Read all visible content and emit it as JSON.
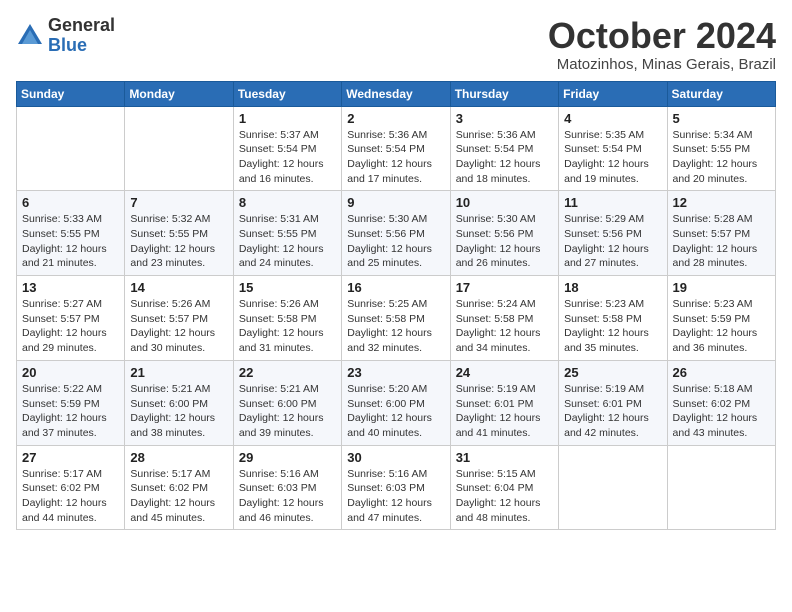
{
  "header": {
    "logo_general": "General",
    "logo_blue": "Blue",
    "month_title": "October 2024",
    "location": "Matozinhos, Minas Gerais, Brazil"
  },
  "weekdays": [
    "Sunday",
    "Monday",
    "Tuesday",
    "Wednesday",
    "Thursday",
    "Friday",
    "Saturday"
  ],
  "weeks": [
    [
      {
        "day": "",
        "info": ""
      },
      {
        "day": "",
        "info": ""
      },
      {
        "day": "1",
        "info": "Sunrise: 5:37 AM\nSunset: 5:54 PM\nDaylight: 12 hours and 16 minutes."
      },
      {
        "day": "2",
        "info": "Sunrise: 5:36 AM\nSunset: 5:54 PM\nDaylight: 12 hours and 17 minutes."
      },
      {
        "day": "3",
        "info": "Sunrise: 5:36 AM\nSunset: 5:54 PM\nDaylight: 12 hours and 18 minutes."
      },
      {
        "day": "4",
        "info": "Sunrise: 5:35 AM\nSunset: 5:54 PM\nDaylight: 12 hours and 19 minutes."
      },
      {
        "day": "5",
        "info": "Sunrise: 5:34 AM\nSunset: 5:55 PM\nDaylight: 12 hours and 20 minutes."
      }
    ],
    [
      {
        "day": "6",
        "info": "Sunrise: 5:33 AM\nSunset: 5:55 PM\nDaylight: 12 hours and 21 minutes."
      },
      {
        "day": "7",
        "info": "Sunrise: 5:32 AM\nSunset: 5:55 PM\nDaylight: 12 hours and 23 minutes."
      },
      {
        "day": "8",
        "info": "Sunrise: 5:31 AM\nSunset: 5:55 PM\nDaylight: 12 hours and 24 minutes."
      },
      {
        "day": "9",
        "info": "Sunrise: 5:30 AM\nSunset: 5:56 PM\nDaylight: 12 hours and 25 minutes."
      },
      {
        "day": "10",
        "info": "Sunrise: 5:30 AM\nSunset: 5:56 PM\nDaylight: 12 hours and 26 minutes."
      },
      {
        "day": "11",
        "info": "Sunrise: 5:29 AM\nSunset: 5:56 PM\nDaylight: 12 hours and 27 minutes."
      },
      {
        "day": "12",
        "info": "Sunrise: 5:28 AM\nSunset: 5:57 PM\nDaylight: 12 hours and 28 minutes."
      }
    ],
    [
      {
        "day": "13",
        "info": "Sunrise: 5:27 AM\nSunset: 5:57 PM\nDaylight: 12 hours and 29 minutes."
      },
      {
        "day": "14",
        "info": "Sunrise: 5:26 AM\nSunset: 5:57 PM\nDaylight: 12 hours and 30 minutes."
      },
      {
        "day": "15",
        "info": "Sunrise: 5:26 AM\nSunset: 5:58 PM\nDaylight: 12 hours and 31 minutes."
      },
      {
        "day": "16",
        "info": "Sunrise: 5:25 AM\nSunset: 5:58 PM\nDaylight: 12 hours and 32 minutes."
      },
      {
        "day": "17",
        "info": "Sunrise: 5:24 AM\nSunset: 5:58 PM\nDaylight: 12 hours and 34 minutes."
      },
      {
        "day": "18",
        "info": "Sunrise: 5:23 AM\nSunset: 5:58 PM\nDaylight: 12 hours and 35 minutes."
      },
      {
        "day": "19",
        "info": "Sunrise: 5:23 AM\nSunset: 5:59 PM\nDaylight: 12 hours and 36 minutes."
      }
    ],
    [
      {
        "day": "20",
        "info": "Sunrise: 5:22 AM\nSunset: 5:59 PM\nDaylight: 12 hours and 37 minutes."
      },
      {
        "day": "21",
        "info": "Sunrise: 5:21 AM\nSunset: 6:00 PM\nDaylight: 12 hours and 38 minutes."
      },
      {
        "day": "22",
        "info": "Sunrise: 5:21 AM\nSunset: 6:00 PM\nDaylight: 12 hours and 39 minutes."
      },
      {
        "day": "23",
        "info": "Sunrise: 5:20 AM\nSunset: 6:00 PM\nDaylight: 12 hours and 40 minutes."
      },
      {
        "day": "24",
        "info": "Sunrise: 5:19 AM\nSunset: 6:01 PM\nDaylight: 12 hours and 41 minutes."
      },
      {
        "day": "25",
        "info": "Sunrise: 5:19 AM\nSunset: 6:01 PM\nDaylight: 12 hours and 42 minutes."
      },
      {
        "day": "26",
        "info": "Sunrise: 5:18 AM\nSunset: 6:02 PM\nDaylight: 12 hours and 43 minutes."
      }
    ],
    [
      {
        "day": "27",
        "info": "Sunrise: 5:17 AM\nSunset: 6:02 PM\nDaylight: 12 hours and 44 minutes."
      },
      {
        "day": "28",
        "info": "Sunrise: 5:17 AM\nSunset: 6:02 PM\nDaylight: 12 hours and 45 minutes."
      },
      {
        "day": "29",
        "info": "Sunrise: 5:16 AM\nSunset: 6:03 PM\nDaylight: 12 hours and 46 minutes."
      },
      {
        "day": "30",
        "info": "Sunrise: 5:16 AM\nSunset: 6:03 PM\nDaylight: 12 hours and 47 minutes."
      },
      {
        "day": "31",
        "info": "Sunrise: 5:15 AM\nSunset: 6:04 PM\nDaylight: 12 hours and 48 minutes."
      },
      {
        "day": "",
        "info": ""
      },
      {
        "day": "",
        "info": ""
      }
    ]
  ]
}
